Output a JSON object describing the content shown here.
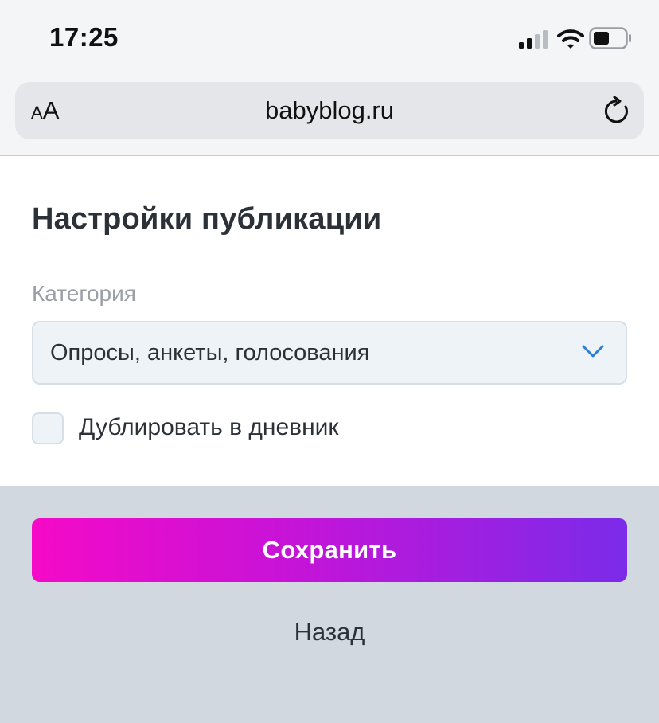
{
  "status_bar": {
    "time": "17:25",
    "icons": [
      "cellular-signal-icon",
      "wifi-icon",
      "battery-icon"
    ]
  },
  "browser": {
    "text_size_small": "A",
    "text_size_big": "A",
    "url": "babyblog.ru",
    "reload_icon": "reload-icon"
  },
  "page": {
    "title": "Настройки публикации",
    "category": {
      "label": "Категория",
      "selected": "Опросы, анкеты, голосования",
      "accent_color": "#2b7fd4"
    },
    "duplicate_checkbox": {
      "label": "Дублировать в дневник",
      "checked": false
    }
  },
  "footer": {
    "save_label": "Сохранить",
    "back_label": "Назад",
    "gradient_colors": [
      "#f50ac7",
      "#c414d8",
      "#7b2be9"
    ]
  }
}
